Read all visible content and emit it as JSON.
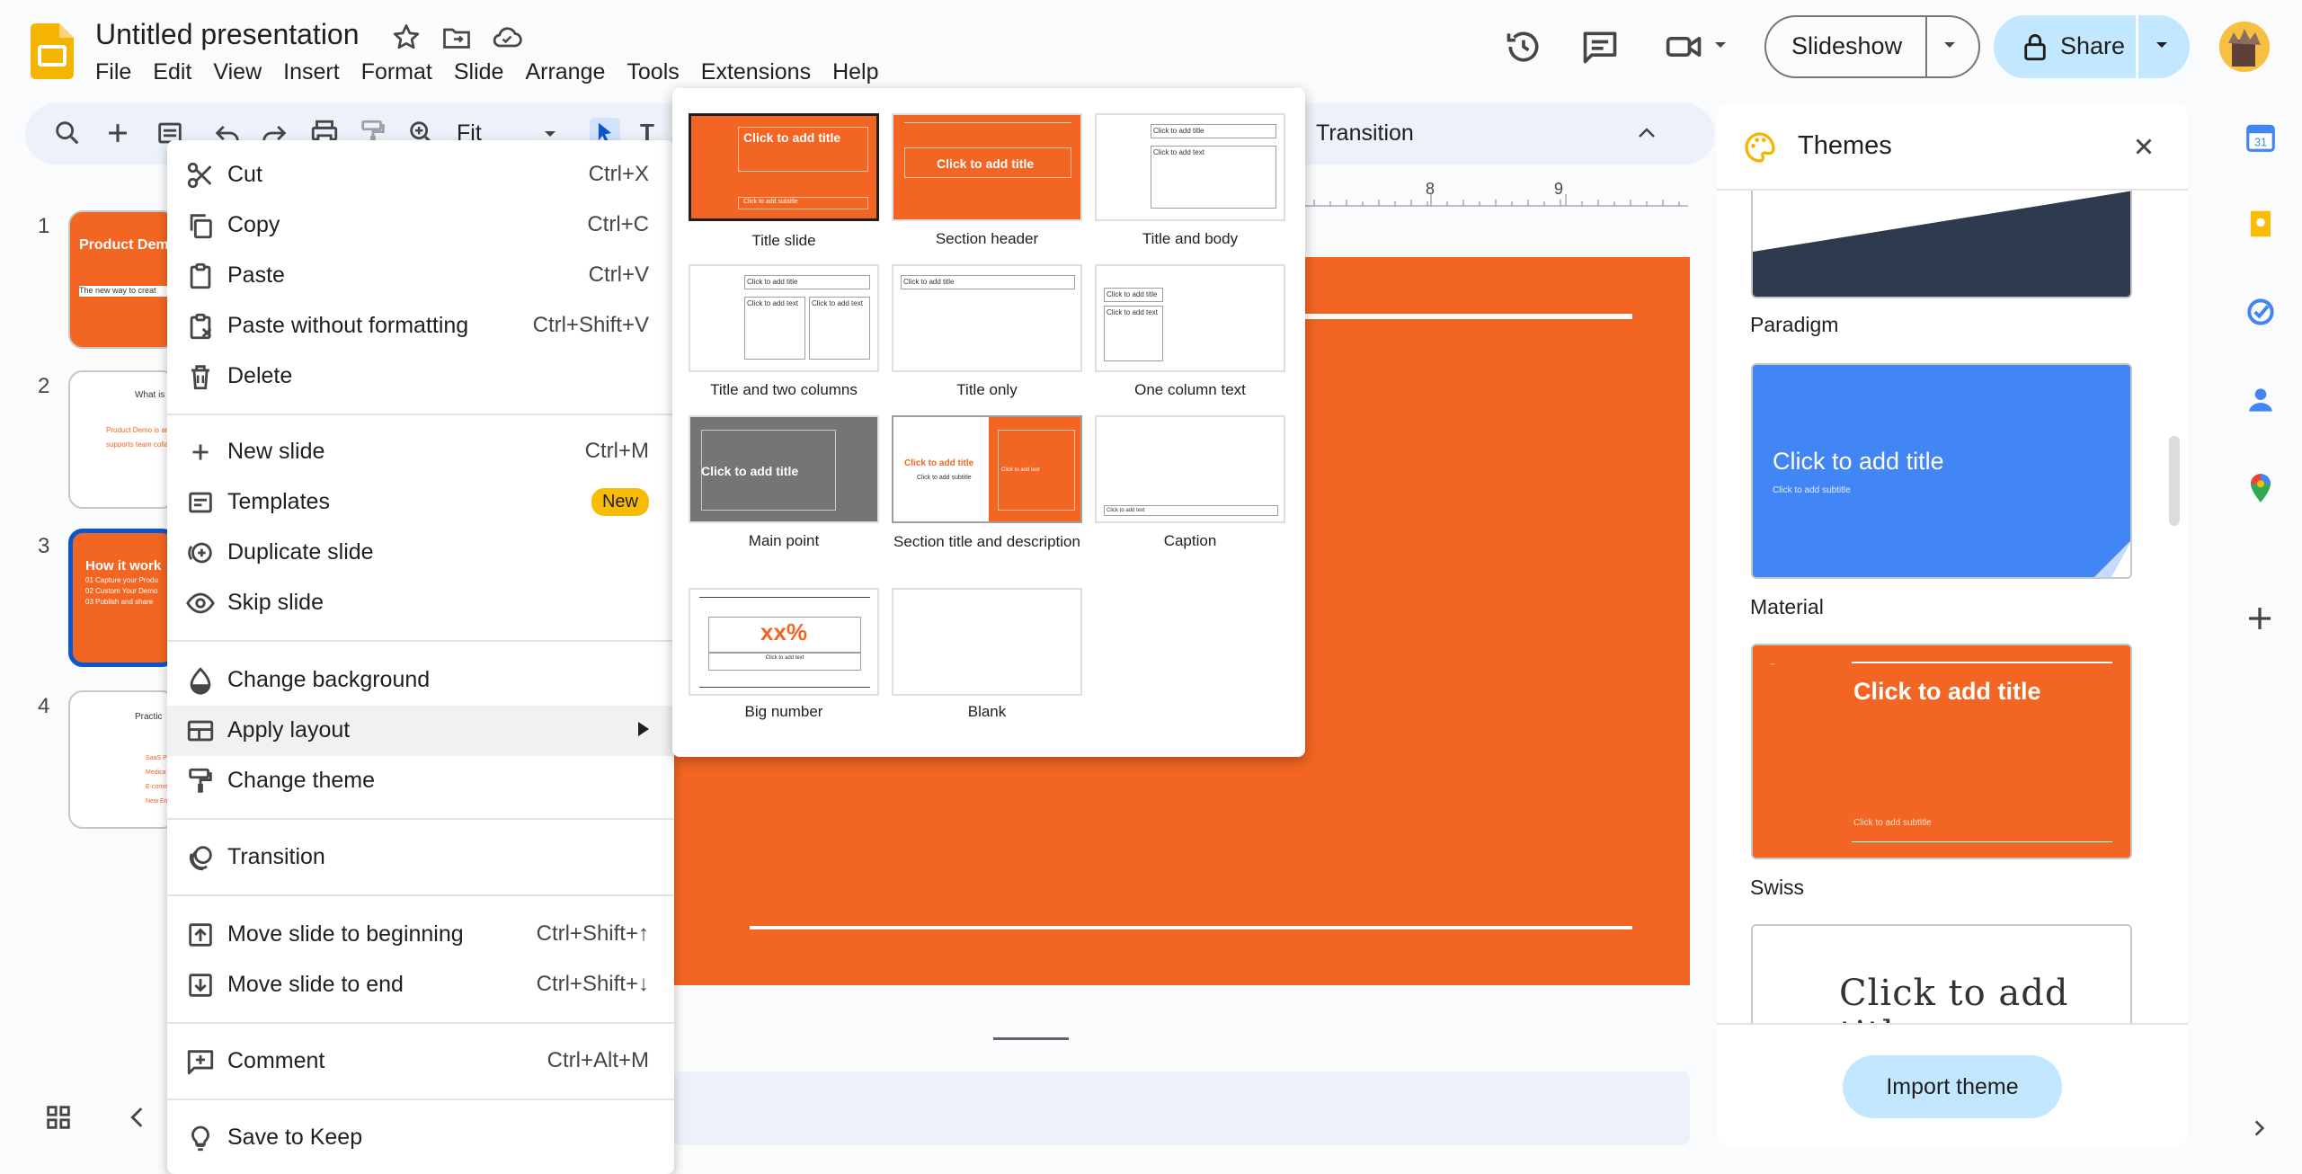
{
  "header": {
    "doc_title": "Untitled presentation",
    "menus": [
      "File",
      "Edit",
      "View",
      "Insert",
      "Format",
      "Slide",
      "Arrange",
      "Tools",
      "Extensions",
      "Help"
    ],
    "slideshow_label": "Slideshow",
    "share_label": "Share"
  },
  "toolbar": {
    "zoom": "Fit",
    "transition_label": "Transition"
  },
  "ruler": {
    "ticks": [
      "8",
      "9"
    ]
  },
  "filmstrip": {
    "slides": [
      {
        "number": "1",
        "title": "Product Dem",
        "subtitle": "The new way to creat"
      },
      {
        "number": "2",
        "title": "What is",
        "body1": "Product Demo is an in",
        "body2": "supports team collabo"
      },
      {
        "number": "3",
        "title": "How it work",
        "b1": "01 Capture your Produ",
        "b2": "02 Custom Your Demo",
        "b3": "03 Publish and share"
      },
      {
        "number": "4",
        "title": "Practic",
        "bullets": [
          "SaaS Pr",
          "Medica",
          "E-comm",
          "New Em"
        ]
      }
    ]
  },
  "context_menu": {
    "cut": {
      "label": "Cut",
      "shortcut": "Ctrl+X"
    },
    "copy": {
      "label": "Copy",
      "shortcut": "Ctrl+C"
    },
    "paste": {
      "label": "Paste",
      "shortcut": "Ctrl+V"
    },
    "paste_plain": {
      "label": "Paste without formatting",
      "shortcut": "Ctrl+Shift+V"
    },
    "delete": {
      "label": "Delete"
    },
    "new_slide": {
      "label": "New slide",
      "shortcut": "Ctrl+M"
    },
    "templates": {
      "label": "Templates",
      "badge": "New"
    },
    "duplicate": {
      "label": "Duplicate slide"
    },
    "skip": {
      "label": "Skip slide"
    },
    "change_bg": {
      "label": "Change background"
    },
    "apply_layout": {
      "label": "Apply layout"
    },
    "change_theme": {
      "label": "Change theme"
    },
    "transition": {
      "label": "Transition"
    },
    "move_begin": {
      "label": "Move slide to beginning",
      "shortcut": "Ctrl+Shift+↑"
    },
    "move_end": {
      "label": "Move slide to end",
      "shortcut": "Ctrl+Shift+↓"
    },
    "comment": {
      "label": "Comment",
      "shortcut": "Ctrl+Alt+M"
    },
    "keep": {
      "label": "Save to Keep"
    }
  },
  "layouts": {
    "placeholder_title": "Click to add title",
    "placeholder_subtitle": "Click to add subtitle",
    "placeholder_text": "Click to add text",
    "big_number_value": "xx%",
    "items": [
      "Title slide",
      "Section header",
      "Title and body",
      "Title and two columns",
      "Title only",
      "One column text",
      "Main point",
      "Section title and description",
      "Caption",
      "Big number",
      "Blank"
    ]
  },
  "themes": {
    "title": "Themes",
    "cards": [
      {
        "name": "Paradigm"
      },
      {
        "name": "Material",
        "title": "Click to add title",
        "subtitle": "Click to add subtitle"
      },
      {
        "name": "Swiss",
        "title": "Click to add title",
        "subtitle": "Click to add subtitle"
      },
      {
        "title": "Click to add title"
      }
    ],
    "import_label": "Import theme"
  },
  "colors": {
    "slide_orange": "#f26522",
    "material_blue": "#4285f4",
    "paradigm_navy": "#2e3a4d",
    "accent_blue": "#0b57d0",
    "share_bg": "#c2e7ff"
  }
}
